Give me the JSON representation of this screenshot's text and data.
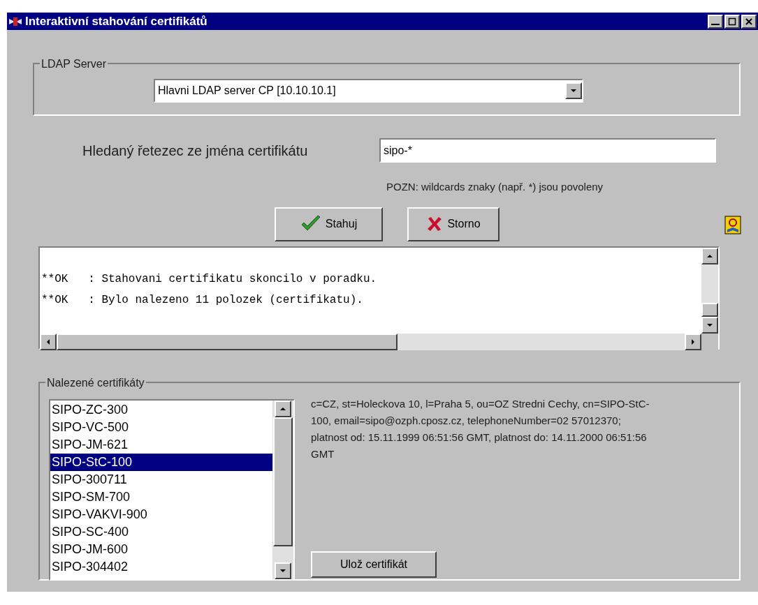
{
  "window": {
    "title": "Interaktivní stahování certifikátů"
  },
  "ldap_server": {
    "legend": "LDAP Server",
    "value": "Hlavni LDAP server CP [10.10.10.1]"
  },
  "search": {
    "label": "Hledaný řetezec ze jména certifikátu",
    "value": "sipo-*",
    "note": "POZN: wildcards znaky (např. *) jsou povoleny"
  },
  "buttons": [
    {
      "label": "Stahuj",
      "kind": "ok"
    },
    {
      "label": "Storno",
      "kind": "cancel"
    }
  ],
  "log": {
    "lines": [
      "**OK   : Stahovani certifikatu skoncilo v poradku.",
      "**OK   : Bylo nalezeno 11 polozek (certifikatu)."
    ]
  },
  "found": {
    "legend": "Nalezené certifikáty",
    "items": [
      {
        "label": "SIPO-ZC-300",
        "selected": false
      },
      {
        "label": "SIPO-VC-500",
        "selected": false
      },
      {
        "label": "SIPO-JM-621",
        "selected": false
      },
      {
        "label": "SIPO-StC-100",
        "selected": true
      },
      {
        "label": "SIPO-300711",
        "selected": false
      },
      {
        "label": "SIPO-SM-700",
        "selected": false
      },
      {
        "label": "SIPO-VAKVI-900",
        "selected": false
      },
      {
        "label": "SIPO-SC-400",
        "selected": false
      },
      {
        "label": "SIPO-JM-600",
        "selected": false
      },
      {
        "label": "SIPO-304402",
        "selected": false
      }
    ],
    "details": "c=CZ, st=Holeckova 10, l=Praha 5, ou=OZ Stredni Cechy, cn=SIPO-StC-100, email=sipo@ozph.cposz.cz, telephoneNumber=02 57012370; platnost od: 15.11.1999 06:51:56 GMT, platnost do: 14.11.2000 06:51:56 GMT",
    "save_button": "Ulož certifikát"
  }
}
